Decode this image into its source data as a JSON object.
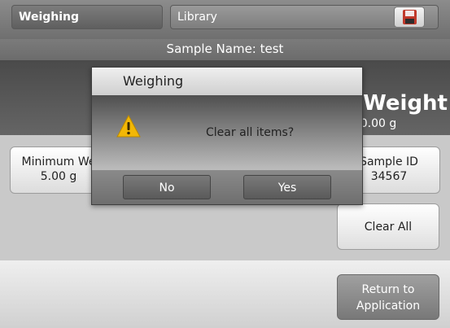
{
  "tabs": {
    "weighing": "Weighing",
    "library": "Library",
    "save_icon": "save-floppy-icon"
  },
  "sample": {
    "name_label": "Sample Name: test"
  },
  "result": {
    "title": "n Weight",
    "value": "0.00 g"
  },
  "cells": {
    "minimum_weight_label": "Minimum We",
    "minimum_weight_value": "5.00 g",
    "sample_id_label": "Sample ID",
    "sample_id_value": "34567"
  },
  "buttons": {
    "clear_all": "Clear All",
    "return_line1": "Return to",
    "return_line2": "Application"
  },
  "dialog": {
    "title": "Weighing",
    "message": "Clear all items?",
    "no": "No",
    "yes": "Yes",
    "icon": "warning-icon"
  },
  "colors": {
    "warning": "#f2b705",
    "save_accent": "#c0392b"
  }
}
